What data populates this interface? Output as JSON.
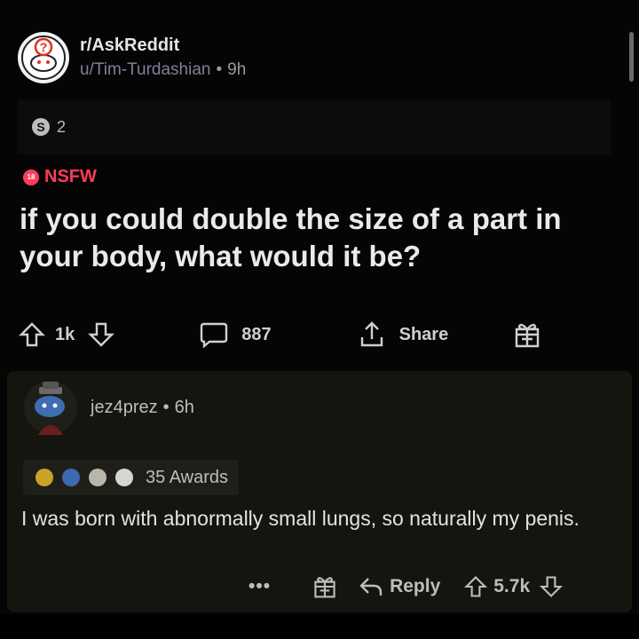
{
  "post": {
    "subreddit": "r/AskReddit",
    "author": "u/Tim-Turdashian",
    "separator": "•",
    "age": "9h",
    "award_count": "2",
    "award_letter": "S",
    "nsfw_label": "NSFW",
    "nsfw_badge": "18",
    "title": "if you could double the size of a part in your body, what would it be?",
    "upvotes": "1k",
    "comments": "887",
    "share_label": "Share"
  },
  "comment": {
    "author": "jez4prez",
    "separator": "•",
    "age": "6h",
    "awards_label": "35 Awards",
    "body": "I was born with abnormally small lungs, so naturally my penis.",
    "more": "•••",
    "reply_label": "Reply",
    "score": "5.7k"
  },
  "colors": {
    "background": "#050505",
    "nsfw": "#ff3c5a",
    "comment_card": "#151510"
  }
}
